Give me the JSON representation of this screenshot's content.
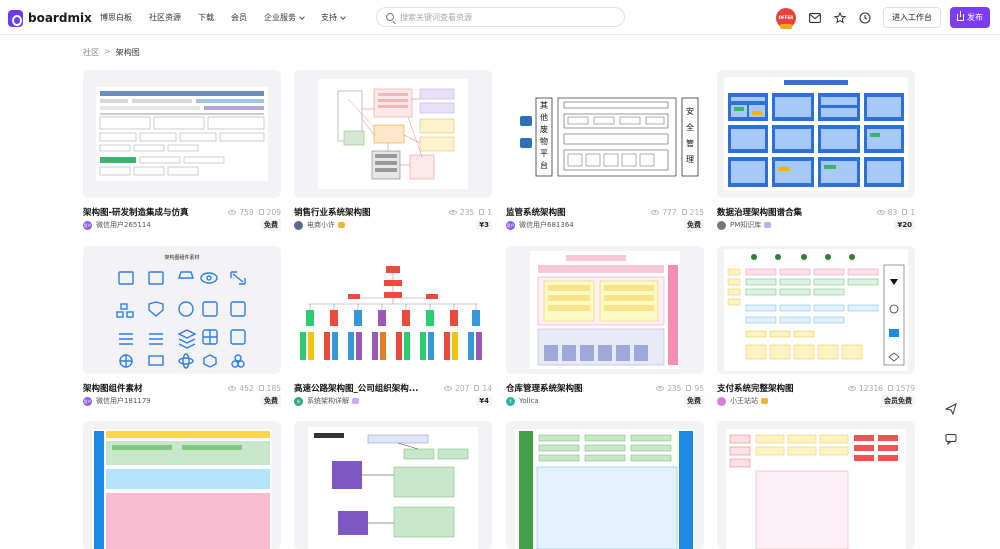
{
  "header": {
    "brand": "boardmix",
    "nav": [
      {
        "label": "博思白板",
        "dropdown": false
      },
      {
        "label": "社区资源",
        "dropdown": false
      },
      {
        "label": "下载",
        "dropdown": false
      },
      {
        "label": "会员",
        "dropdown": false
      },
      {
        "label": "企业服务",
        "dropdown": true
      },
      {
        "label": "支持",
        "dropdown": true
      }
    ],
    "search_placeholder": "搜索关键词查看资源",
    "promo_badge": "OFFER",
    "workspace_button": "进入工作台",
    "publish_button": "发布"
  },
  "breadcrumb": {
    "root": "社区",
    "separator": ">",
    "current": "架构图"
  },
  "cards": [
    {
      "title": "架构图-研发制造集成与仿真",
      "views": "759",
      "copies": "209",
      "author": "微信用户265114",
      "avatar_text": "用户",
      "avatar_color": "#8b5cf6",
      "vip": false,
      "price": "免费",
      "thumb": "arch"
    },
    {
      "title": "销售行业系统架构图",
      "views": "235",
      "copies": "1",
      "author": "电商小许",
      "avatar_text": "",
      "avatar_color": "#5a6b8c",
      "vip": true,
      "vip_color": "gold",
      "price": "¥3",
      "thumb": "sales"
    },
    {
      "title": "监管系统架构图",
      "views": "777",
      "copies": "215",
      "author": "微信用户681364",
      "avatar_text": "用户",
      "avatar_color": "#8b5cf6",
      "vip": false,
      "price": "免费",
      "thumb": "monitor"
    },
    {
      "title": "数据治理架构图谱合集",
      "views": "83",
      "copies": "1",
      "author": "PM知识库",
      "avatar_text": "",
      "avatar_color": "#777777",
      "vip": true,
      "vip_color": "purple",
      "price": "¥20",
      "thumb": "data"
    },
    {
      "title": "架构图组件素材",
      "views": "452",
      "copies": "185",
      "author": "微信用户181179",
      "avatar_text": "用户",
      "avatar_color": "#8b5cf6",
      "vip": false,
      "price": "免费",
      "thumb": "icons"
    },
    {
      "title": "高速公路架构图_公司组织架构...",
      "views": "207",
      "copies": "14",
      "author": "系统架构详解",
      "avatar_text": "系",
      "avatar_color": "#2aa876",
      "vip": true,
      "vip_color": "purple",
      "price": "¥4",
      "thumb": "org"
    },
    {
      "title": "仓库管理系统架构图",
      "views": "235",
      "copies": "95",
      "author": "Yolica",
      "avatar_text": "Y",
      "avatar_color": "#2bb5a0",
      "vip": false,
      "price": "免费",
      "thumb": "warehouse"
    },
    {
      "title": "支付系统完整架构图",
      "views": "12316",
      "copies": "1579",
      "author": "小王站站",
      "avatar_text": "",
      "avatar_color": "#d77fd0",
      "vip": true,
      "vip_color": "gold",
      "price": "会员免费",
      "thumb": "payment"
    },
    {
      "title": "",
      "thumb": "row3a"
    },
    {
      "title": "",
      "thumb": "row3b"
    },
    {
      "title": "",
      "thumb": "row3c"
    },
    {
      "title": "",
      "thumb": "row3d"
    }
  ],
  "thumbnail_text": {
    "monitor_left": [
      "其",
      "他",
      "废",
      "物",
      "平",
      "台"
    ],
    "monitor_right": [
      "安",
      "全",
      "管",
      "理"
    ],
    "icons_title": "架构图组件素材"
  }
}
